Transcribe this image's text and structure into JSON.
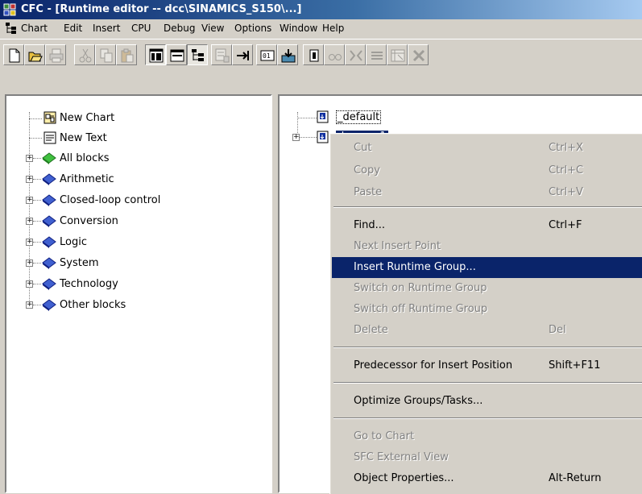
{
  "window": {
    "title": "CFC - [Runtime editor -- dcc\\SINAMICS_S150\\...]"
  },
  "menu": {
    "items": [
      "Chart",
      "Edit",
      "Insert",
      "CPU",
      "Debug",
      "View",
      "Options",
      "Window",
      "Help"
    ]
  },
  "toolbar": {
    "buttons": [
      "new-icon",
      "open-icon",
      "print-icon",
      "cut-icon",
      "copy-icon",
      "paste-icon",
      "catalog-icon",
      "window-icon",
      "runtime-icon",
      "chart-icon",
      "insert-point-icon",
      "compile-icon",
      "download-icon",
      "test-mode-icon",
      "watch-icon",
      "block-icon",
      "column-icon",
      "value-icon",
      "close-icon"
    ]
  },
  "left_tree": {
    "items": [
      {
        "label": "New Chart",
        "icon": "chart-icon",
        "expandable": false
      },
      {
        "label": "New Text",
        "icon": "text-icon",
        "expandable": false
      },
      {
        "label": "All blocks",
        "icon": "all-blocks-icon",
        "expandable": true
      },
      {
        "label": "Arithmetic",
        "icon": "block-library-icon",
        "expandable": true
      },
      {
        "label": "Closed-loop control",
        "icon": "block-library-icon",
        "expandable": true
      },
      {
        "label": "Conversion",
        "icon": "block-library-icon",
        "expandable": true
      },
      {
        "label": "Logic",
        "icon": "block-library-icon",
        "expandable": true
      },
      {
        "label": "System",
        "icon": "block-library-icon",
        "expandable": true
      },
      {
        "label": "Technology",
        "icon": "block-library-icon",
        "expandable": true
      },
      {
        "label": "Other blocks",
        "icon": "block-library-icon",
        "expandable": true
      }
    ]
  },
  "right_tree": {
    "items": [
      {
        "label": "_default",
        "selected": false,
        "expandable": false
      },
      {
        "label": "dcc_sgp1",
        "selected": true,
        "expandable": true
      }
    ]
  },
  "context_menu": {
    "items": [
      {
        "label": "Cut",
        "shortcut": "Ctrl+X",
        "disabled": true
      },
      {
        "label": "Copy",
        "shortcut": "Ctrl+C",
        "disabled": true
      },
      {
        "label": "Paste",
        "shortcut": "Ctrl+V",
        "disabled": true
      },
      {
        "label": "Find...",
        "shortcut": "Ctrl+F",
        "disabled": false
      },
      {
        "label": "Next Insert Point",
        "shortcut": "",
        "disabled": true
      },
      {
        "label": "Insert Runtime Group...",
        "shortcut": "",
        "disabled": false,
        "highlighted": true
      },
      {
        "label": "Switch on Runtime Group",
        "shortcut": "",
        "disabled": true
      },
      {
        "label": "Switch off Runtime Group",
        "shortcut": "",
        "disabled": true
      },
      {
        "label": "Delete",
        "shortcut": "Del",
        "disabled": true
      },
      {
        "label": "Predecessor for Insert Position",
        "shortcut": "Shift+F11",
        "disabled": false
      },
      {
        "label": "Optimize Groups/Tasks...",
        "shortcut": "",
        "disabled": false
      },
      {
        "label": "Go to Chart",
        "shortcut": "",
        "disabled": true
      },
      {
        "label": "SFC External View",
        "shortcut": "",
        "disabled": true
      },
      {
        "label": "Object Properties...",
        "shortcut": "Alt-Return",
        "disabled": false
      }
    ]
  },
  "colors": {
    "title_bar": "#0a246a",
    "highlight": "#0a246a",
    "face": "#d4d0c8",
    "disabled_text": "#808080"
  }
}
